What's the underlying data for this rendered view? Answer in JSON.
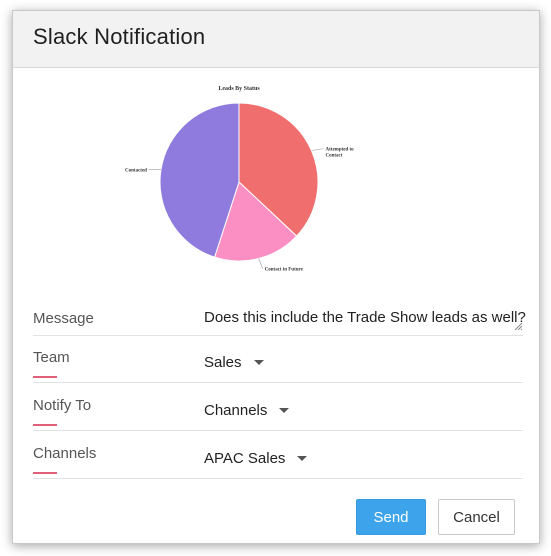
{
  "dialog": {
    "title": "Slack Notification"
  },
  "chart_data": {
    "type": "pie",
    "title": "Leads By Status",
    "categories": [
      "Attempted to Contact",
      "Contact in Future",
      "Contacted"
    ],
    "label_lines": [
      [
        "Attempted to",
        "Contact"
      ],
      [
        "Contact in Future"
      ],
      [
        "Contacted"
      ]
    ],
    "values": [
      37,
      18,
      45
    ],
    "colors": [
      "#f06e6e",
      "#fb8fc3",
      "#8e7bdd"
    ]
  },
  "form": {
    "message": {
      "label": "Message",
      "value": "Does this include the Trade Show leads as well?"
    },
    "team": {
      "label": "Team",
      "value": "Sales"
    },
    "notify_to": {
      "label": "Notify To",
      "value": "Channels"
    },
    "channels": {
      "label": "Channels",
      "value": "APAC Sales"
    }
  },
  "buttons": {
    "send": "Send",
    "cancel": "Cancel"
  },
  "colors": {
    "primary": "#3da3ea",
    "required_accent": "#e0607a",
    "header_bg": "#f2f2f3"
  }
}
